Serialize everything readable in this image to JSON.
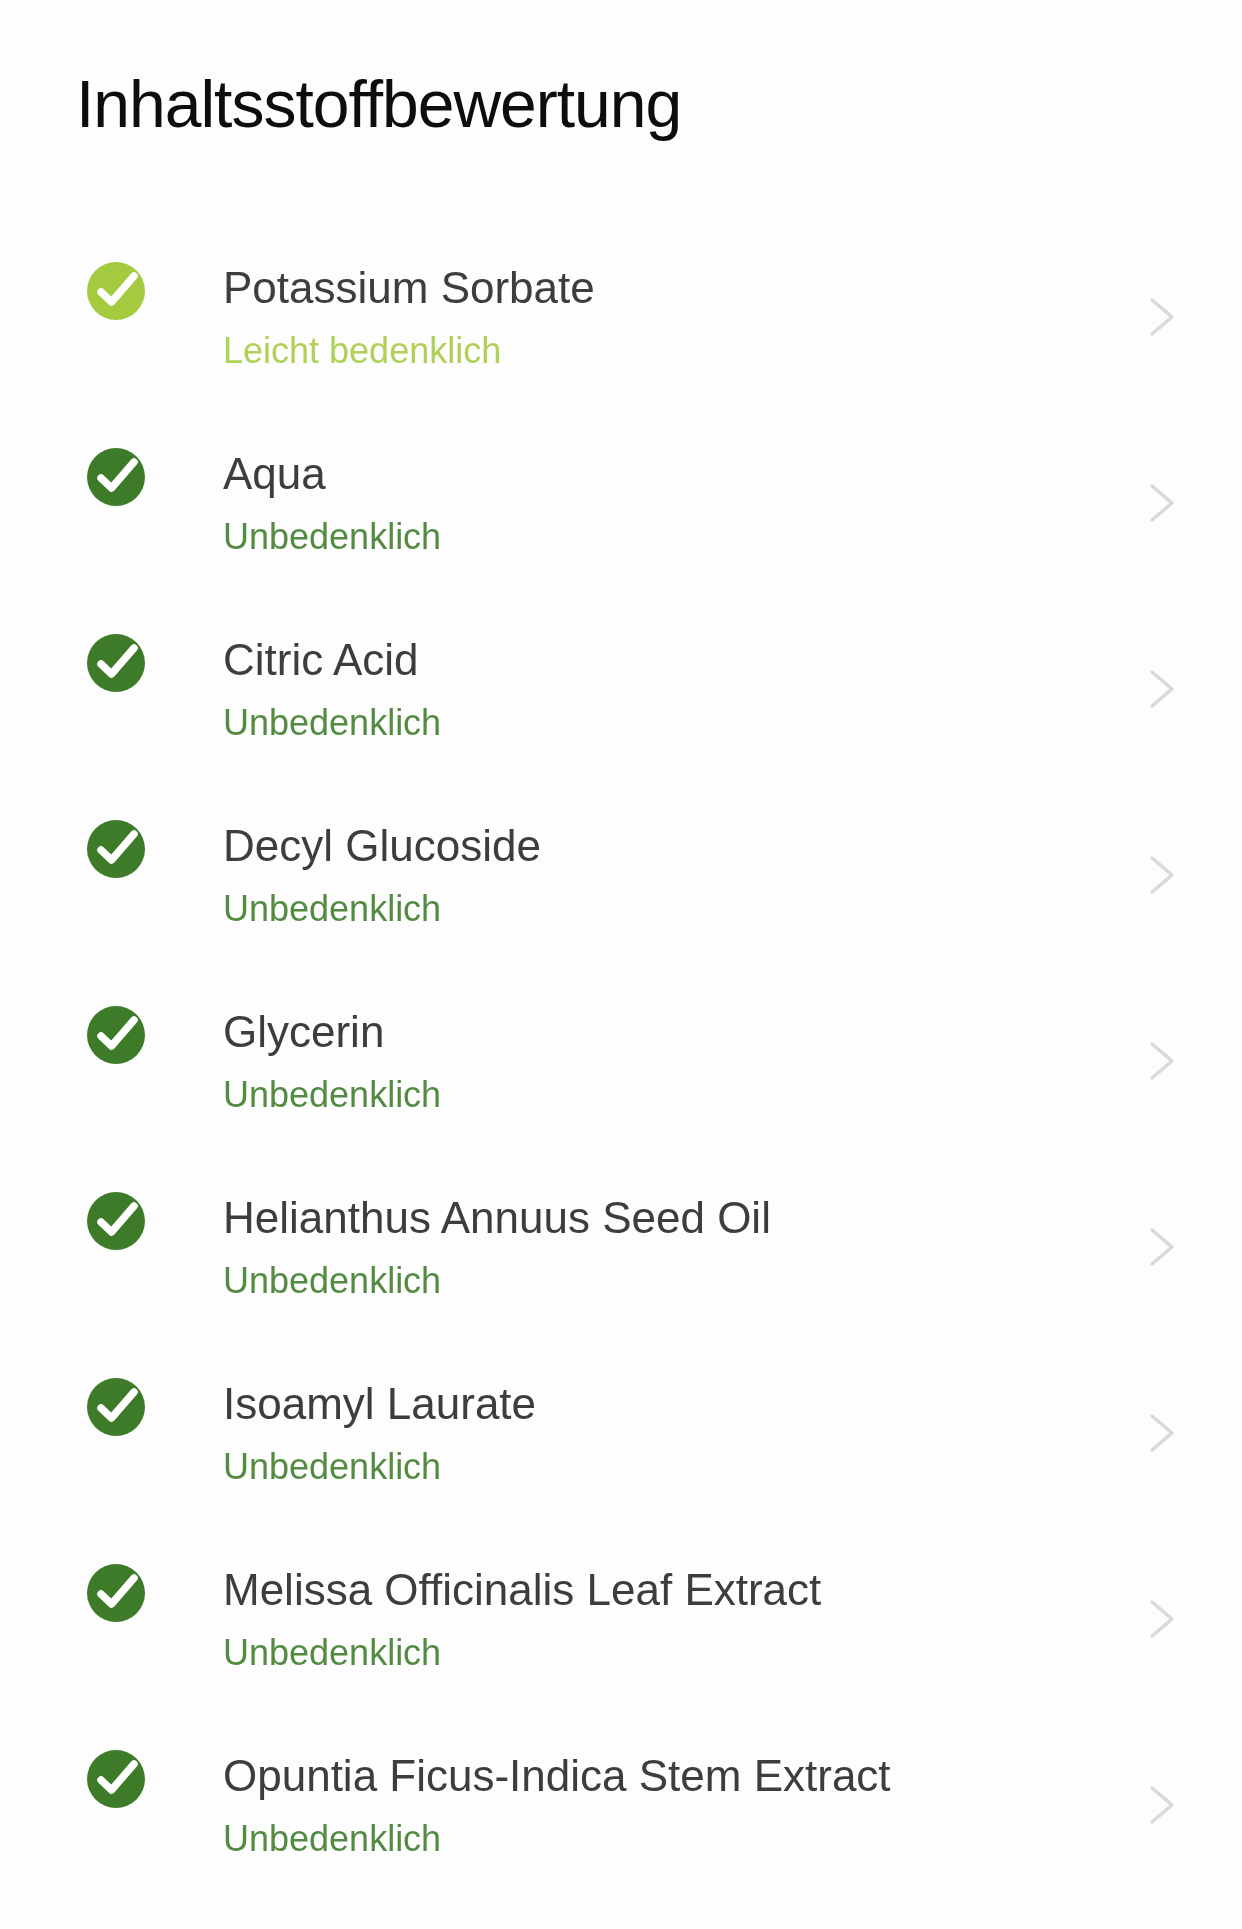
{
  "title": "Inhaltsstoffbewertung",
  "ingredients": [
    {
      "name": "Potassium Sorbate",
      "rating": "Leicht bedenklich",
      "color": "#a4cb40"
    },
    {
      "name": "Aqua",
      "rating": "Unbedenklich",
      "color": "#3d7b29"
    },
    {
      "name": "Citric Acid",
      "rating": "Unbedenklich",
      "color": "#3d7b29"
    },
    {
      "name": "Decyl Glucoside",
      "rating": "Unbedenklich",
      "color": "#3d7b29"
    },
    {
      "name": "Glycerin",
      "rating": "Unbedenklich",
      "color": "#3d7b29"
    },
    {
      "name": "Helianthus Annuus Seed Oil",
      "rating": "Unbedenklich",
      "color": "#3d7b29"
    },
    {
      "name": "Isoamyl Laurate",
      "rating": "Unbedenklich",
      "color": "#3d7b29"
    },
    {
      "name": "Melissa Officinalis Leaf Extract",
      "rating": "Unbedenklich",
      "color": "#3d7b29"
    },
    {
      "name": "Opuntia Ficus-Indica Stem Extract",
      "rating": "Unbedenklich",
      "color": "#3d7b29"
    }
  ]
}
